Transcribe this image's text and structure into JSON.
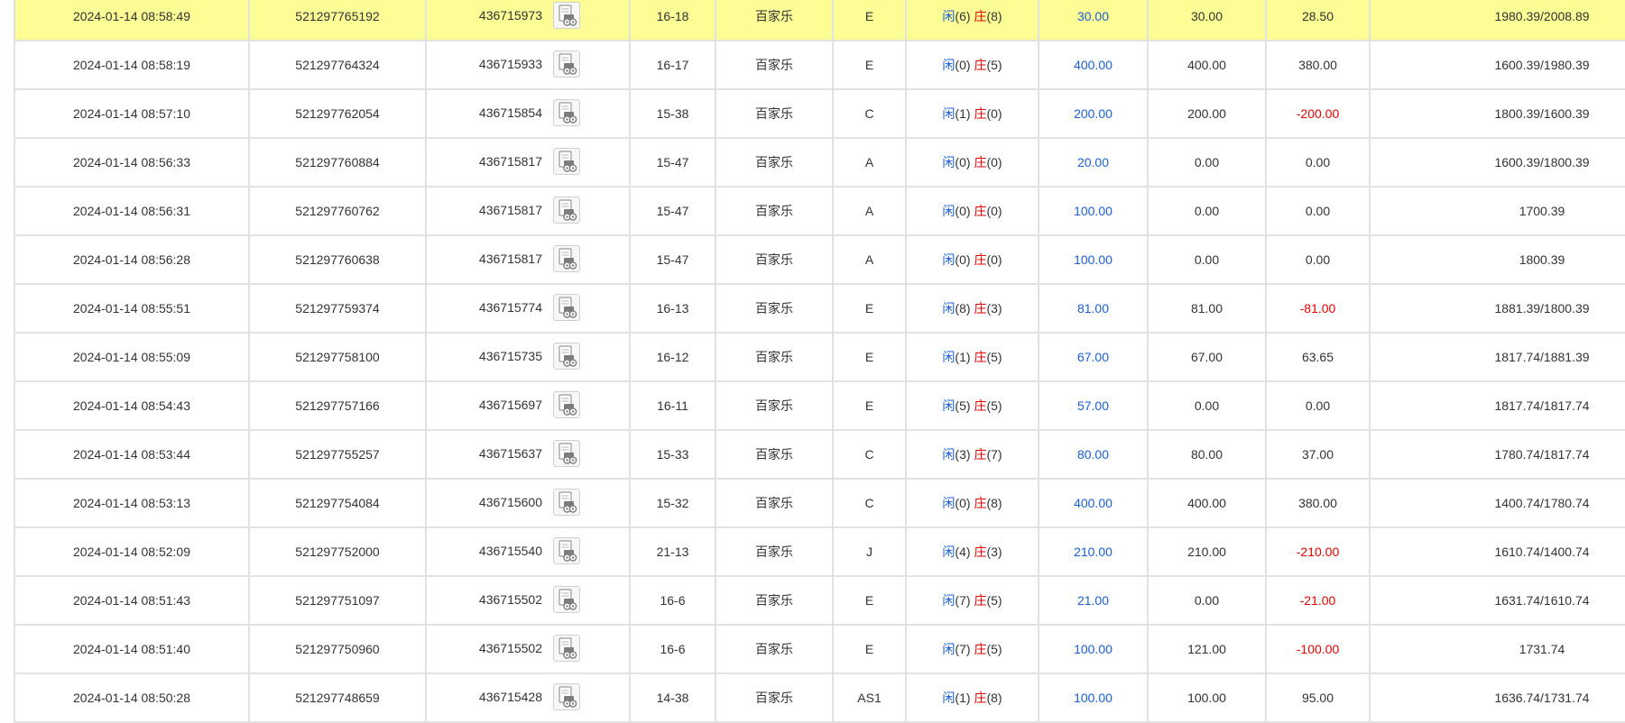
{
  "colors": {
    "highlight_row": "#fdfd96",
    "bet_amount": "#1a5fd6",
    "player_label": "#1a5fd6",
    "banker_label": "#e60000",
    "negative_win": "#e60000",
    "border": "#e2e2e2"
  },
  "icons": {
    "detail": "video-detail-icon"
  },
  "rows": [
    {
      "time": "2024-01-14 08:58:49",
      "order": "521297765192",
      "game_id": "436715973",
      "round": "16-18",
      "game": "百家乐",
      "table": "E",
      "player_label": "闲",
      "player": "(6)",
      "banker_label": "庄",
      "banker": "(8)",
      "bet": "30.00",
      "valid": "30.00",
      "win": "28.50",
      "win_negative": false,
      "balance": "1980.39/2008.89",
      "highlight": true
    },
    {
      "time": "2024-01-14 08:58:19",
      "order": "521297764324",
      "game_id": "436715933",
      "round": "16-17",
      "game": "百家乐",
      "table": "E",
      "player_label": "闲",
      "player": "(0)",
      "banker_label": "庄",
      "banker": "(5)",
      "bet": "400.00",
      "valid": "400.00",
      "win": "380.00",
      "win_negative": false,
      "balance": "1600.39/1980.39",
      "highlight": false
    },
    {
      "time": "2024-01-14 08:57:10",
      "order": "521297762054",
      "game_id": "436715854",
      "round": "15-38",
      "game": "百家乐",
      "table": "C",
      "player_label": "闲",
      "player": "(1)",
      "banker_label": "庄",
      "banker": "(0)",
      "bet": "200.00",
      "valid": "200.00",
      "win": "-200.00",
      "win_negative": true,
      "balance": "1800.39/1600.39",
      "highlight": false
    },
    {
      "time": "2024-01-14 08:56:33",
      "order": "521297760884",
      "game_id": "436715817",
      "round": "15-47",
      "game": "百家乐",
      "table": "A",
      "player_label": "闲",
      "player": "(0)",
      "banker_label": "庄",
      "banker": "(0)",
      "bet": "20.00",
      "valid": "0.00",
      "win": "0.00",
      "win_negative": false,
      "balance": "1600.39/1800.39",
      "highlight": false
    },
    {
      "time": "2024-01-14 08:56:31",
      "order": "521297760762",
      "game_id": "436715817",
      "round": "15-47",
      "game": "百家乐",
      "table": "A",
      "player_label": "闲",
      "player": "(0)",
      "banker_label": "庄",
      "banker": "(0)",
      "bet": "100.00",
      "valid": "0.00",
      "win": "0.00",
      "win_negative": false,
      "balance": "1700.39",
      "highlight": false
    },
    {
      "time": "2024-01-14 08:56:28",
      "order": "521297760638",
      "game_id": "436715817",
      "round": "15-47",
      "game": "百家乐",
      "table": "A",
      "player_label": "闲",
      "player": "(0)",
      "banker_label": "庄",
      "banker": "(0)",
      "bet": "100.00",
      "valid": "0.00",
      "win": "0.00",
      "win_negative": false,
      "balance": "1800.39",
      "highlight": false
    },
    {
      "time": "2024-01-14 08:55:51",
      "order": "521297759374",
      "game_id": "436715774",
      "round": "16-13",
      "game": "百家乐",
      "table": "E",
      "player_label": "闲",
      "player": "(8)",
      "banker_label": "庄",
      "banker": "(3)",
      "bet": "81.00",
      "valid": "81.00",
      "win": "-81.00",
      "win_negative": true,
      "balance": "1881.39/1800.39",
      "highlight": false
    },
    {
      "time": "2024-01-14 08:55:09",
      "order": "521297758100",
      "game_id": "436715735",
      "round": "16-12",
      "game": "百家乐",
      "table": "E",
      "player_label": "闲",
      "player": "(1)",
      "banker_label": "庄",
      "banker": "(5)",
      "bet": "67.00",
      "valid": "67.00",
      "win": "63.65",
      "win_negative": false,
      "balance": "1817.74/1881.39",
      "highlight": false
    },
    {
      "time": "2024-01-14 08:54:43",
      "order": "521297757166",
      "game_id": "436715697",
      "round": "16-11",
      "game": "百家乐",
      "table": "E",
      "player_label": "闲",
      "player": "(5)",
      "banker_label": "庄",
      "banker": "(5)",
      "bet": "57.00",
      "valid": "0.00",
      "win": "0.00",
      "win_negative": false,
      "balance": "1817.74/1817.74",
      "highlight": false
    },
    {
      "time": "2024-01-14 08:53:44",
      "order": "521297755257",
      "game_id": "436715637",
      "round": "15-33",
      "game": "百家乐",
      "table": "C",
      "player_label": "闲",
      "player": "(3)",
      "banker_label": "庄",
      "banker": "(7)",
      "bet": "80.00",
      "valid": "80.00",
      "win": "37.00",
      "win_negative": false,
      "balance": "1780.74/1817.74",
      "highlight": false
    },
    {
      "time": "2024-01-14 08:53:13",
      "order": "521297754084",
      "game_id": "436715600",
      "round": "15-32",
      "game": "百家乐",
      "table": "C",
      "player_label": "闲",
      "player": "(0)",
      "banker_label": "庄",
      "banker": "(8)",
      "bet": "400.00",
      "valid": "400.00",
      "win": "380.00",
      "win_negative": false,
      "balance": "1400.74/1780.74",
      "highlight": false
    },
    {
      "time": "2024-01-14 08:52:09",
      "order": "521297752000",
      "game_id": "436715540",
      "round": "21-13",
      "game": "百家乐",
      "table": "J",
      "player_label": "闲",
      "player": "(4)",
      "banker_label": "庄",
      "banker": "(3)",
      "bet": "210.00",
      "valid": "210.00",
      "win": "-210.00",
      "win_negative": true,
      "balance": "1610.74/1400.74",
      "highlight": false
    },
    {
      "time": "2024-01-14 08:51:43",
      "order": "521297751097",
      "game_id": "436715502",
      "round": "16-6",
      "game": "百家乐",
      "table": "E",
      "player_label": "闲",
      "player": "(7)",
      "banker_label": "庄",
      "banker": "(5)",
      "bet": "21.00",
      "valid": "0.00",
      "win": "-21.00",
      "win_negative": true,
      "balance": "1631.74/1610.74",
      "highlight": false
    },
    {
      "time": "2024-01-14 08:51:40",
      "order": "521297750960",
      "game_id": "436715502",
      "round": "16-6",
      "game": "百家乐",
      "table": "E",
      "player_label": "闲",
      "player": "(7)",
      "banker_label": "庄",
      "banker": "(5)",
      "bet": "100.00",
      "valid": "121.00",
      "win": "-100.00",
      "win_negative": true,
      "balance": "1731.74",
      "highlight": false
    },
    {
      "time": "2024-01-14 08:50:28",
      "order": "521297748659",
      "game_id": "436715428",
      "round": "14-38",
      "game": "百家乐",
      "table": "AS1",
      "player_label": "闲",
      "player": "(1)",
      "banker_label": "庄",
      "banker": "(8)",
      "bet": "100.00",
      "valid": "100.00",
      "win": "95.00",
      "win_negative": false,
      "balance": "1636.74/1731.74",
      "highlight": false
    }
  ]
}
